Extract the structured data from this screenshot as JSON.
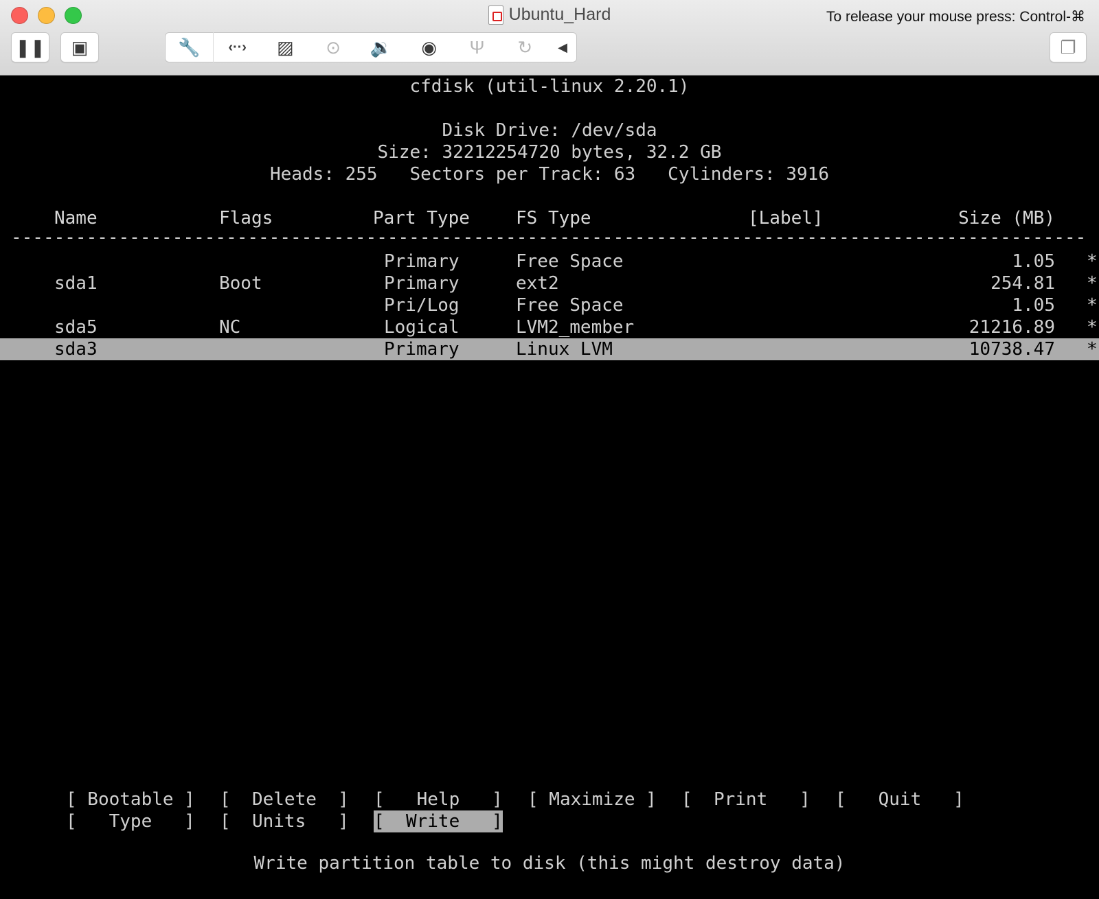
{
  "window": {
    "title": "Ubuntu_Hard",
    "release_hint": "To release your mouse press: Control-⌘"
  },
  "toolbar": {
    "left_buttons": [
      {
        "icon": "pause-icon",
        "glyph": "❚❚"
      },
      {
        "icon": "snapshot-icon",
        "glyph": "▣"
      }
    ],
    "tools": [
      {
        "icon": "wrench-icon",
        "glyph": "🔧",
        "enabled": true
      },
      {
        "icon": "network-icon",
        "glyph": "‹··›",
        "enabled": true
      },
      {
        "icon": "hard-disk-icon",
        "glyph": "▨",
        "enabled": true
      },
      {
        "icon": "optical-drive-icon",
        "glyph": "⊙",
        "enabled": false
      },
      {
        "icon": "sound-icon",
        "glyph": "🔉",
        "enabled": true
      },
      {
        "icon": "camera-icon",
        "glyph": "◉",
        "enabled": true
      },
      {
        "icon": "usb-icon",
        "glyph": "Ψ",
        "enabled": false
      },
      {
        "icon": "sync-icon",
        "glyph": "↻",
        "enabled": false
      },
      {
        "icon": "collapse-arrow-icon",
        "glyph": "◀",
        "enabled": true
      }
    ],
    "right_button": {
      "icon": "restore-windows-icon",
      "glyph": "❐"
    }
  },
  "cfdisk": {
    "program": "cfdisk (util-linux 2.20.1)",
    "disk_drive": "Disk Drive: /dev/sda",
    "size_line": "Size: 32212254720 bytes, 32.2 GB",
    "geometry_line": "Heads: 255   Sectors per Track: 63   Cylinders: 3916",
    "columns": {
      "name": "Name",
      "flags": "Flags",
      "part_type": "Part Type",
      "fs_type": "FS Type",
      "label": "[Label]",
      "size": "Size (MB)"
    },
    "rule": "------------------------------------------------------------------------------------------------------------------------",
    "partitions": [
      {
        "name": "",
        "flags": "",
        "part_type": "Primary",
        "fs_type": "Free Space",
        "size": "1.05",
        "mark": "*",
        "selected": false
      },
      {
        "name": "sda1",
        "flags": "Boot",
        "part_type": "Primary",
        "fs_type": "ext2",
        "size": "254.81",
        "mark": "*",
        "selected": false
      },
      {
        "name": "",
        "flags": "",
        "part_type": "Pri/Log",
        "fs_type": "Free Space",
        "size": "1.05",
        "mark": "*",
        "selected": false
      },
      {
        "name": "sda5",
        "flags": "NC",
        "part_type": "Logical",
        "fs_type": "LVM2_member",
        "size": "21216.89",
        "mark": "*",
        "selected": false
      },
      {
        "name": "sda3",
        "flags": "",
        "part_type": "Primary",
        "fs_type": "Linux LVM",
        "size": "10738.47",
        "mark": "*",
        "selected": true
      }
    ],
    "menu_row1": [
      "[ Bootable ]",
      "[  Delete  ]",
      "[   Help   ]",
      "[ Maximize ]",
      "[  Print   ]",
      "[   Quit   ]"
    ],
    "menu_row2": [
      "[   Type   ]",
      "[  Units   ]",
      "[  Write   ]"
    ],
    "selected_menu": "Write",
    "status": "Write partition table to disk (this might destroy data)"
  }
}
